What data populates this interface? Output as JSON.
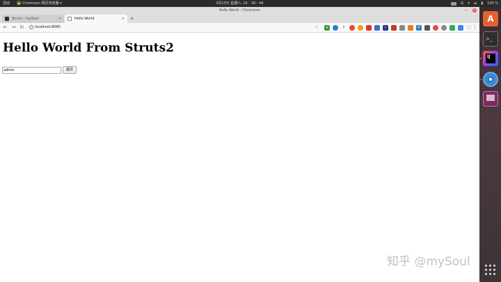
{
  "top_panel": {
    "activities": "活动",
    "app_menu": "Chromium 网页浏览器 ▾",
    "clock": "3月23日 星期六, 16：18：44",
    "battery": "100 %"
  },
  "window": {
    "title": "Hello World - Chromium",
    "tabs": [
      {
        "label": "Struts - mySoul"
      },
      {
        "label": "Hello World"
      }
    ],
    "address": "localhost:8080"
  },
  "page": {
    "heading": "Hello World From Struts2",
    "username_value": "admin",
    "submit_label": "提交"
  },
  "watermark": "知乎 @mySoul",
  "colors": {
    "dock_accent": "#f36e3b",
    "panel_bg": "#2b2b2b"
  },
  "icons": [
    "chromium-icon",
    "star-icon",
    "menu-icon",
    "back-icon",
    "forward-icon",
    "reload-icon",
    "info-icon",
    "app-grid-icon"
  ]
}
